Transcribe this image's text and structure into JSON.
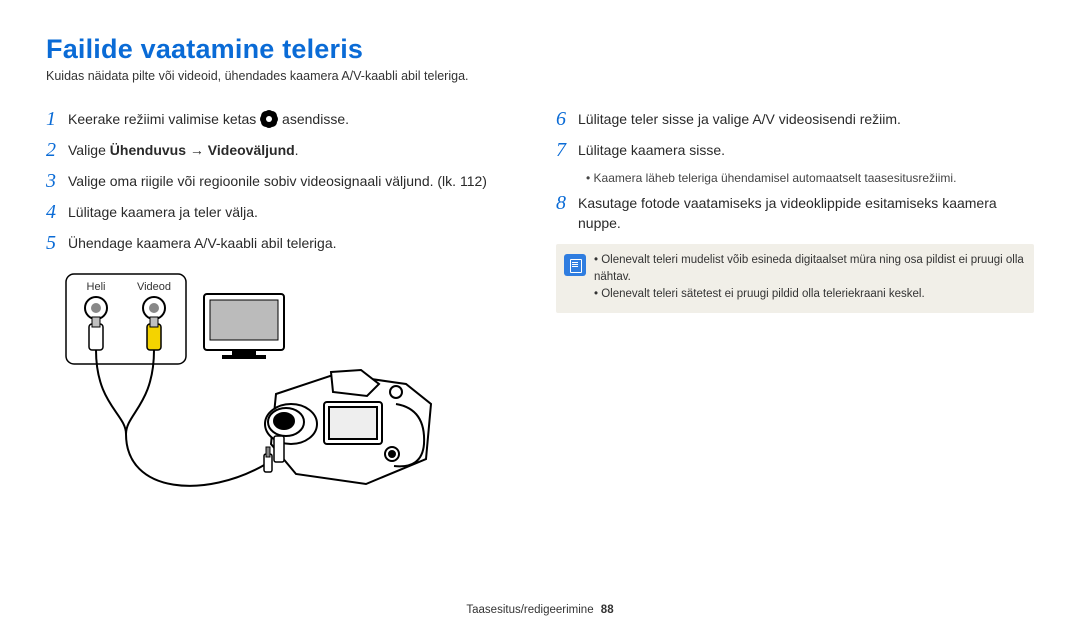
{
  "title": "Failide vaatamine teleris",
  "subtitle": "Kuidas näidata pilte või videoid, ühendades kaamera A/V-kaabli abil teleriga.",
  "left": {
    "s1_a": "Keerake režiimi valimise ketas ",
    "s1_b": " asendisse.",
    "s2_a": "Valige ",
    "s2_bold1": "Ühenduvus",
    "s2_arrow": " → ",
    "s2_bold2": "Videoväljund",
    "s2_end": ".",
    "s3": "Valige oma riigile või regioonile sobiv videosignaali väljund. (lk. 112)",
    "s4": "Lülitage kaamera ja teler välja.",
    "s5": "Ühendage kaamera A/V-kaabli abil teleriga."
  },
  "right": {
    "s6": "Lülitage teler sisse ja valige A/V videosisendi režiim.",
    "s7": "Lülitage kaamera sisse.",
    "s7_sub": "Kaamera läheb teleriga ühendamisel automaatselt taasesitusrežiimi.",
    "s8": "Kasutage fotode vaatamiseks ja videoklippide esitamiseks kaamera nuppe."
  },
  "note": {
    "l1": "Olenevalt teleri mudelist võib esineda digitaalset müra ning osa pildist ei pruugi olla nähtav.",
    "l2": "Olenevalt teleri sätetest ei pruugi pildid olla teleriekraani keskel."
  },
  "diagram": {
    "label_audio": "Heli",
    "label_video": "Videod"
  },
  "footer": {
    "section": "Taasesitus/redigeerimine",
    "page": "88"
  }
}
